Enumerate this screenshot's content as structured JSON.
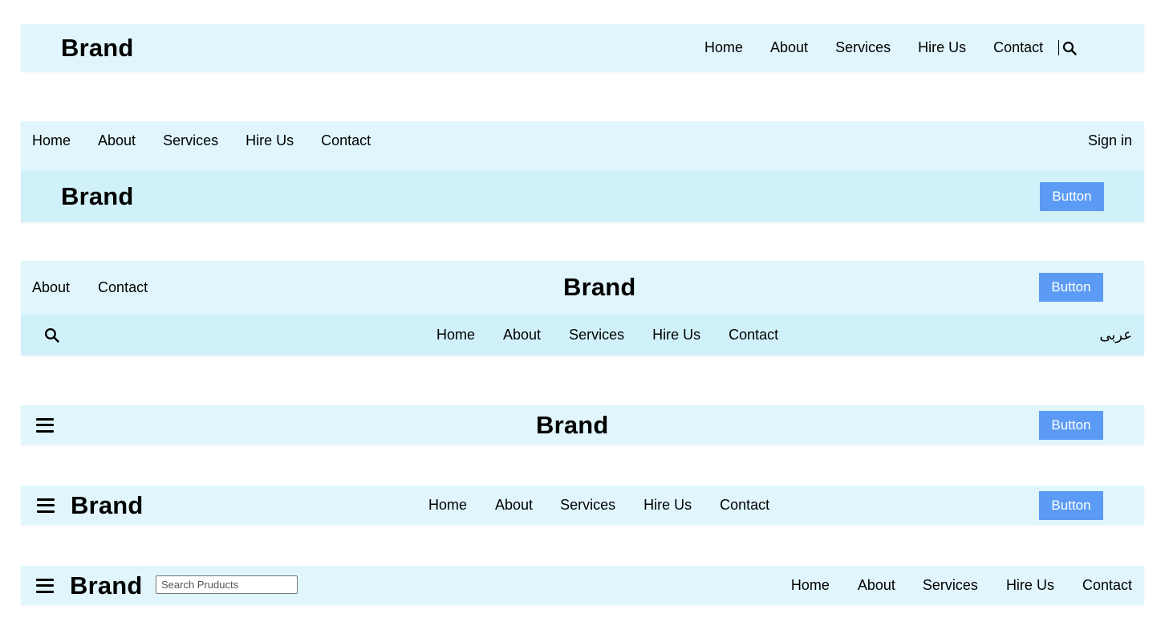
{
  "colors": {
    "bar_background": "#e0f6fc",
    "bar_background_dark": "#d1f1fa",
    "button_background": "#5b9bf5",
    "button_text": "#ffffff"
  },
  "navbar1": {
    "brand": "Brand",
    "links": [
      "Home",
      "About",
      "Services",
      "Hire Us",
      "Contact"
    ],
    "search_icon": "search-icon"
  },
  "navbar2": {
    "top_links": [
      "Home",
      "About",
      "Services",
      "Hire Us",
      "Contact"
    ],
    "sign_in": "Sign in",
    "brand": "Brand",
    "button": "Button"
  },
  "navbar3": {
    "top_links": [
      "About",
      "Contact"
    ],
    "brand": "Brand",
    "button": "Button",
    "search_icon": "search-icon",
    "bottom_links": [
      "Home",
      "About",
      "Services",
      "Hire Us",
      "Contact"
    ],
    "language": "عربى"
  },
  "navbar4": {
    "menu_icon": "hamburger-icon",
    "brand": "Brand",
    "button": "Button"
  },
  "navbar5": {
    "menu_icon": "hamburger-icon",
    "brand": "Brand",
    "links": [
      "Home",
      "About",
      "Services",
      "Hire Us",
      "Contact"
    ],
    "button": "Button"
  },
  "navbar6": {
    "menu_icon": "hamburger-icon",
    "brand": "Brand",
    "search_placeholder": "Search Pruducts",
    "links": [
      "Home",
      "About",
      "Services",
      "Hire Us",
      "Contact"
    ]
  }
}
